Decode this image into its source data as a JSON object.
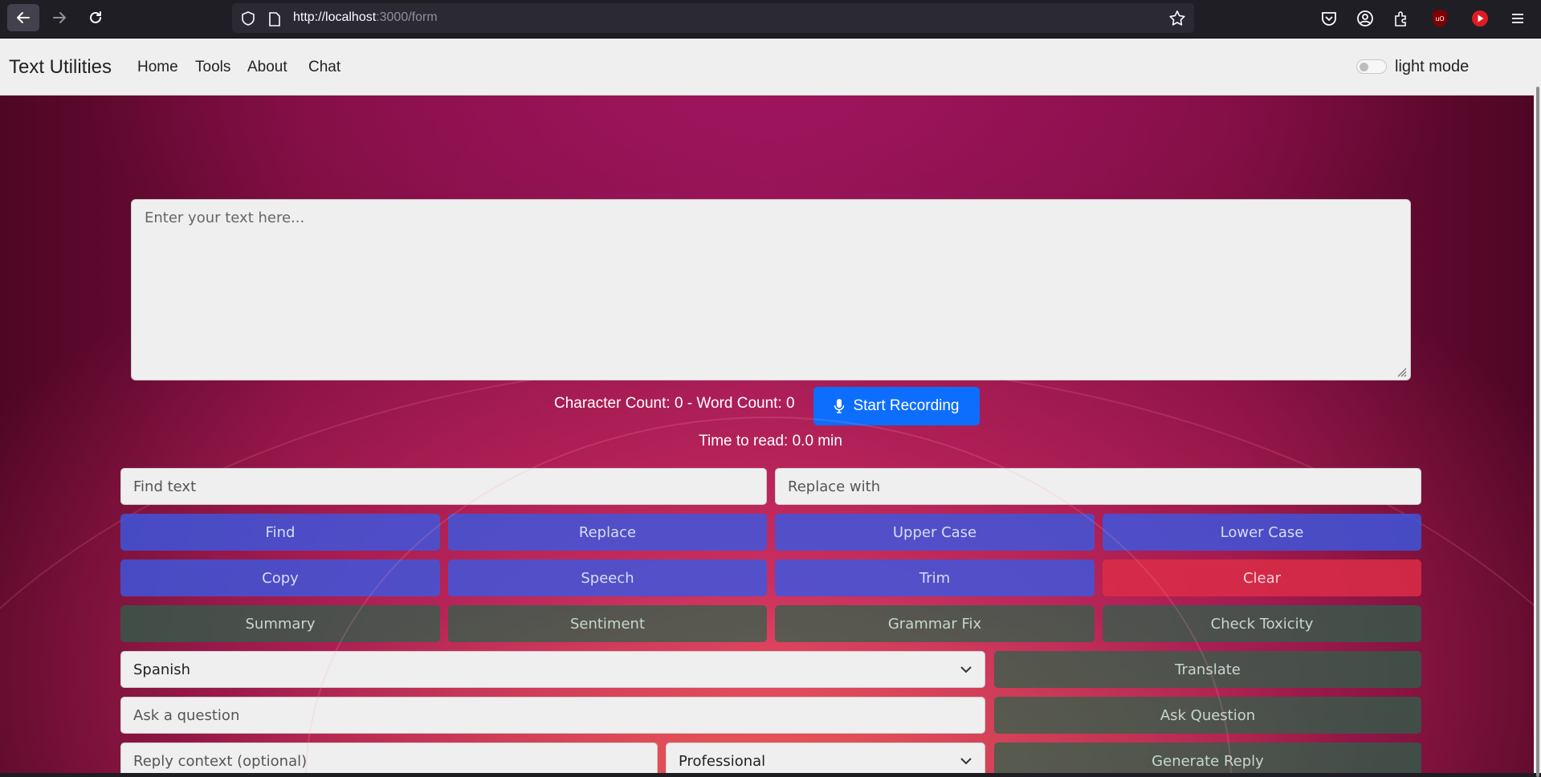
{
  "browser": {
    "url_host": "http://localhost",
    "url_rest": ":3000/form"
  },
  "navbar": {
    "brand": "Text Utilities",
    "links": [
      "Home",
      "Tools",
      "About",
      "Chat"
    ],
    "mode_label": "light mode"
  },
  "editor": {
    "placeholder": "Enter your text here...",
    "counts": "Character Count: 0 - Word Count: 0",
    "record_label": "Start Recording",
    "read_time": "Time to read: 0.0 min"
  },
  "find_replace": {
    "find_placeholder": "Find text",
    "replace_placeholder": "Replace with"
  },
  "buttons": {
    "row1": [
      "Find",
      "Replace",
      "Upper Case",
      "Lower Case"
    ],
    "row2": [
      "Copy",
      "Speech",
      "Trim",
      "Clear"
    ],
    "row3": [
      "Summary",
      "Sentiment",
      "Grammar Fix",
      "Check Toxicity"
    ]
  },
  "translate": {
    "language": "Spanish",
    "button": "Translate"
  },
  "question": {
    "placeholder": "Ask a question",
    "button": "Ask Question"
  },
  "reply": {
    "context_placeholder": "Reply context (optional)",
    "tone": "Professional",
    "button": "Generate Reply"
  },
  "colors": {
    "primary_blue": "#0d6efd",
    "tool_blue": "#3a58e1",
    "tool_red": "#dc2d46",
    "tool_green": "#28644b"
  }
}
